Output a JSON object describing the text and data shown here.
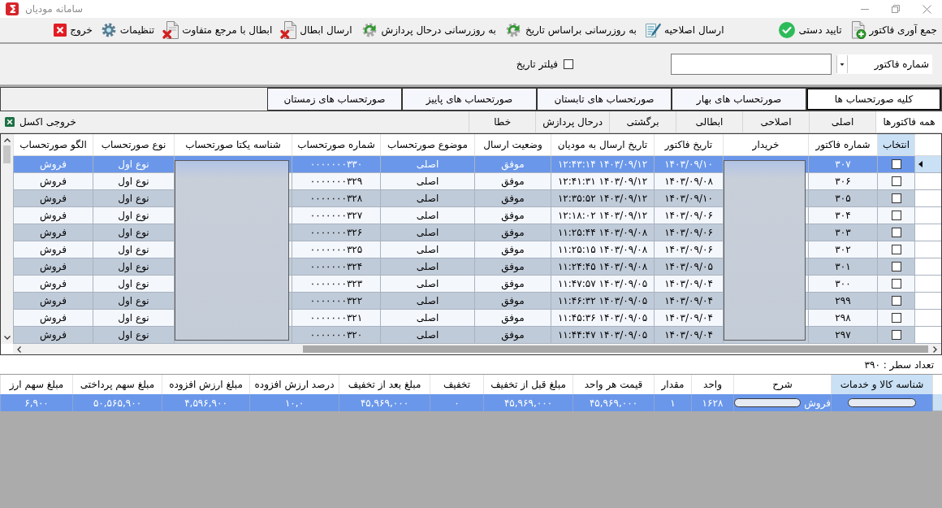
{
  "window": {
    "title": "سامانه مودیان"
  },
  "toolbar": {
    "groups": [
      {
        "items": [
          {
            "label": "جمع آوری فاکتور",
            "kind": "collect"
          },
          {
            "label": "تایید دستی",
            "kind": "confirm"
          }
        ]
      },
      {
        "items": [
          {
            "label": "ارسال اصلاحیه",
            "kind": "amend"
          },
          {
            "label": "به روزرسانی براساس تاریخ",
            "kind": "refresh"
          },
          {
            "label": "به روزرسانی درحال پردازش",
            "kind": "refresh"
          },
          {
            "label": "ارسال ابطال",
            "kind": "void"
          },
          {
            "label": "ابطال با مرجع متفاوت",
            "kind": "void"
          },
          {
            "label": "تنظیمات",
            "kind": "settings"
          },
          {
            "label": "خروج",
            "kind": "exit"
          }
        ]
      }
    ]
  },
  "filter": {
    "field": {
      "value": "شماره فاکتور"
    },
    "date_filter": {
      "label": "فیلتر تاریخ",
      "checked": false
    }
  },
  "period_tabs": [
    {
      "label": "کلیه صورتحساب ها",
      "selected": true
    },
    {
      "label": "صورتحساب های بهار",
      "selected": false
    },
    {
      "label": "صورتحساب های تابستان",
      "selected": false
    },
    {
      "label": "صورتحساب های پاییز",
      "selected": false
    },
    {
      "label": "صورتحساب های زمستان",
      "selected": false
    }
  ],
  "status_tabs": [
    {
      "label": "همه فاکتورها",
      "selected": true
    },
    {
      "label": "اصلی",
      "selected": false
    },
    {
      "label": "اصلاحی",
      "selected": false
    },
    {
      "label": "ابطالی",
      "selected": false
    },
    {
      "label": "برگشتی",
      "selected": false
    },
    {
      "label": "درحال پردازش",
      "selected": false
    },
    {
      "label": "خطا",
      "selected": false
    }
  ],
  "export_button": {
    "label": "خروجی اکسل"
  },
  "invoices": {
    "columns": [
      {
        "label": "انتخاب",
        "kind": "checkbox",
        "highlighted": true
      },
      {
        "label": "شماره فاکتور",
        "kind": "text",
        "highlighted": false
      },
      {
        "label": "خریدار",
        "kind": "redacted",
        "highlighted": false
      },
      {
        "label": "تاریخ فاکتور",
        "kind": "text",
        "highlighted": false
      },
      {
        "label": "تاریخ ارسال به مودیان",
        "kind": "text",
        "highlighted": false
      },
      {
        "label": "وضعیت ارسال",
        "kind": "text",
        "highlighted": false
      },
      {
        "label": "موضوع صورتحساب",
        "kind": "text",
        "highlighted": false
      },
      {
        "label": "شماره صورتحساب",
        "kind": "text",
        "highlighted": false
      },
      {
        "label": "شناسه یکتا صورتحساب",
        "kind": "redacted",
        "highlighted": false
      },
      {
        "label": "نوع صورتحساب",
        "kind": "text",
        "highlighted": false
      },
      {
        "label": "الگو صورتحساب",
        "kind": "text",
        "highlighted": false
      }
    ],
    "rows": [
      {
        "selected": true,
        "checked": false,
        "values": [
          "۳۰۷",
          "۱۴۰۳/۰۹/۱۰",
          "۱۴۰۳/۰۹/۱۲ ۱۲:۴۳:۱۴",
          "موفق",
          "اصلی",
          "۰۰۰۰۰۰۰۳۳۰",
          "نوع اول",
          "فروش"
        ]
      },
      {
        "selected": false,
        "checked": false,
        "values": [
          "۳۰۶",
          "۱۴۰۳/۰۹/۰۸",
          "۱۴۰۳/۰۹/۱۲ ۱۲:۴۱:۳۱",
          "موفق",
          "اصلی",
          "۰۰۰۰۰۰۰۳۲۹",
          "نوع اول",
          "فروش"
        ]
      },
      {
        "selected": false,
        "checked": false,
        "values": [
          "۳۰۵",
          "۱۴۰۳/۰۹/۱۰",
          "۱۴۰۳/۰۹/۱۲ ۱۲:۳۵:۵۲",
          "موفق",
          "اصلی",
          "۰۰۰۰۰۰۰۳۲۸",
          "نوع اول",
          "فروش"
        ]
      },
      {
        "selected": false,
        "checked": false,
        "values": [
          "۳۰۴",
          "۱۴۰۳/۰۹/۰۶",
          "۱۴۰۳/۰۹/۱۲ ۱۲:۱۸:۰۲",
          "موفق",
          "اصلی",
          "۰۰۰۰۰۰۰۳۲۷",
          "نوع اول",
          "فروش"
        ]
      },
      {
        "selected": false,
        "checked": false,
        "values": [
          "۳۰۳",
          "۱۴۰۳/۰۹/۰۶",
          "۱۴۰۳/۰۹/۰۸ ۱۱:۲۵:۴۴",
          "موفق",
          "اصلی",
          "۰۰۰۰۰۰۰۳۲۶",
          "نوع اول",
          "فروش"
        ]
      },
      {
        "selected": false,
        "checked": false,
        "values": [
          "۳۰۲",
          "۱۴۰۳/۰۹/۰۶",
          "۱۴۰۳/۰۹/۰۸ ۱۱:۲۵:۱۵",
          "موفق",
          "اصلی",
          "۰۰۰۰۰۰۰۳۲۵",
          "نوع اول",
          "فروش"
        ]
      },
      {
        "selected": false,
        "checked": false,
        "values": [
          "۳۰۱",
          "۱۴۰۳/۰۹/۰۵",
          "۱۴۰۳/۰۹/۰۸ ۱۱:۲۴:۴۵",
          "موفق",
          "اصلی",
          "۰۰۰۰۰۰۰۳۲۴",
          "نوع اول",
          "فروش"
        ]
      },
      {
        "selected": false,
        "checked": false,
        "values": [
          "۳۰۰",
          "۱۴۰۳/۰۹/۰۴",
          "۱۴۰۳/۰۹/۰۵ ۱۱:۴۷:۵۷",
          "موفق",
          "اصلی",
          "۰۰۰۰۰۰۰۳۲۳",
          "نوع اول",
          "فروش"
        ]
      },
      {
        "selected": false,
        "checked": false,
        "values": [
          "۲۹۹",
          "۱۴۰۳/۰۹/۰۴",
          "۱۴۰۳/۰۹/۰۵ ۱۱:۴۶:۳۲",
          "موفق",
          "اصلی",
          "۰۰۰۰۰۰۰۳۲۲",
          "نوع اول",
          "فروش"
        ]
      },
      {
        "selected": false,
        "checked": false,
        "values": [
          "۲۹۸",
          "۱۴۰۳/۰۹/۰۴",
          "۱۴۰۳/۰۹/۰۵ ۱۱:۴۵:۳۶",
          "موفق",
          "اصلی",
          "۰۰۰۰۰۰۰۳۲۱",
          "نوع اول",
          "فروش"
        ]
      },
      {
        "selected": false,
        "checked": false,
        "values": [
          "۲۹۷",
          "۱۴۰۳/۰۹/۰۴",
          "۱۴۰۳/۰۹/۰۵ ۱۱:۴۴:۴۷",
          "موفق",
          "اصلی",
          "۰۰۰۰۰۰۰۳۲۰",
          "نوع اول",
          "فروش"
        ]
      }
    ]
  },
  "row_count": "تعداد سطر : ۳۹۰",
  "items_table": {
    "columns": [
      {
        "label": "شناسه کالا و خدمات",
        "highlighted": true
      },
      {
        "label": "شرح",
        "highlighted": false
      },
      {
        "label": "واحد",
        "highlighted": false
      },
      {
        "label": "مقدار",
        "highlighted": false
      },
      {
        "label": "قیمت هر واحد",
        "highlighted": false
      },
      {
        "label": "مبلغ قبل از تخفیف",
        "highlighted": false
      },
      {
        "label": "تخفیف",
        "highlighted": false
      },
      {
        "label": "مبلغ بعد از تخفیف",
        "highlighted": false
      },
      {
        "label": "درصد ارزش افزوده",
        "highlighted": false
      },
      {
        "label": "مبلغ ارزش افزوده",
        "highlighted": false
      },
      {
        "label": "مبلغ سهم پرداختی",
        "highlighted": false
      },
      {
        "label": "مبلغ سهم ارز",
        "highlighted": false
      }
    ],
    "rows": [
      {
        "selected": true,
        "cells": [
          {
            "redacted": true
          },
          {
            "text": "فروش",
            "redacted": true
          },
          {
            "text": "۱۶۲۸",
            "redacted": false
          },
          {
            "text": "۱",
            "redacted": false
          },
          {
            "text": "۴۵,۹۶۹,۰۰۰",
            "redacted": false
          },
          {
            "text": "۴۵,۹۶۹,۰۰۰",
            "redacted": false
          },
          {
            "text": "۰",
            "redacted": false
          },
          {
            "text": "۴۵,۹۶۹,۰۰۰",
            "redacted": false
          },
          {
            "text": "۱۰,۰",
            "redacted": false
          },
          {
            "text": "۴,۵۹۶,۹۰۰",
            "redacted": false
          },
          {
            "text": "۵۰,۵۶۵,۹۰۰",
            "redacted": false
          },
          {
            "text": "۶,۹۰۰",
            "redacted": false
          }
        ]
      }
    ]
  }
}
